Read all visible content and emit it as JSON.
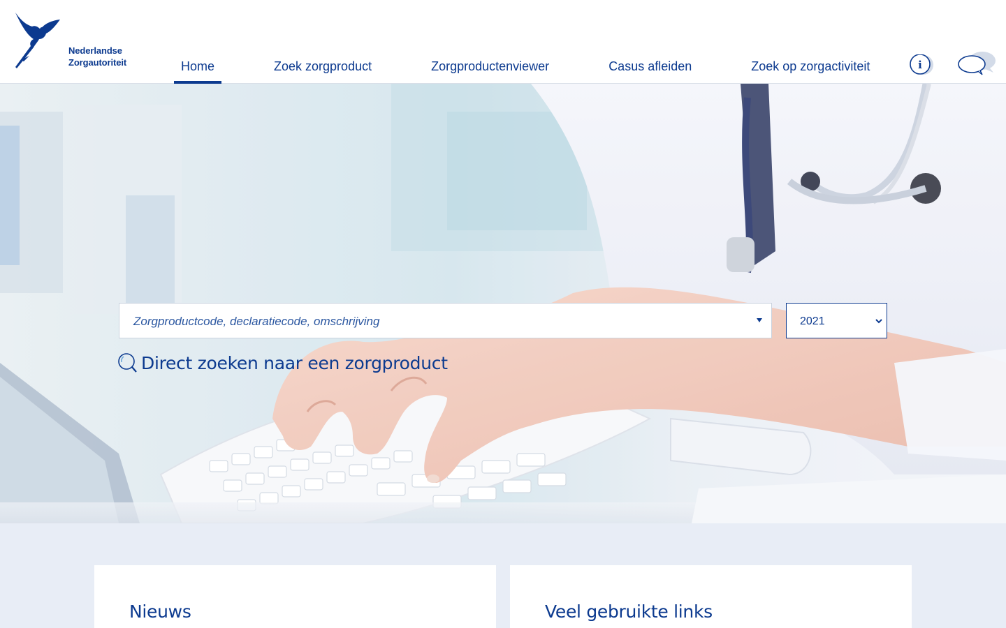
{
  "brand": {
    "line1": "Nederlandse",
    "line2": "Zorgautoriteit",
    "color": "#0c3a8f"
  },
  "nav": {
    "items": [
      {
        "label": "Home",
        "active": true
      },
      {
        "label": "Zoek zorgproduct",
        "active": false
      },
      {
        "label": "Zorgproductenviewer",
        "active": false
      },
      {
        "label": "Casus afleiden",
        "active": false
      },
      {
        "label": "Zoek op zorgactiviteit",
        "active": false
      }
    ],
    "info_icon": "info-icon",
    "chat_icon": "chat-bubble-icon"
  },
  "hero": {
    "heading": "Direct zoeken naar een zorgproduct",
    "search_placeholder": "Zorgproductcode, declaratiecode, omschrijving",
    "year_selected": "2021",
    "search_icon": "search-icon"
  },
  "cards": {
    "news_title": "Nieuws",
    "links_title": "Veel gebruikte links"
  },
  "colors": {
    "primary": "#0c3a8f",
    "page_background": "#e8edf6",
    "card_background": "#ffffff"
  }
}
